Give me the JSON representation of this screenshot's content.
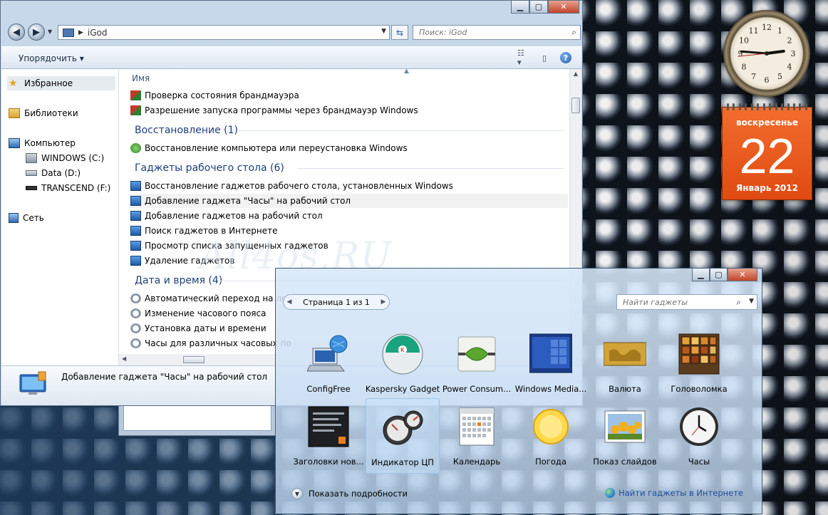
{
  "explorer": {
    "address": {
      "crumb": "iGod"
    },
    "search": {
      "placeholder": "Поиск: iGod"
    },
    "toolbar": {
      "organize_label": "Упорядочить ▾"
    },
    "nav": {
      "favorites": "Избранное",
      "libraries": "Библиотеки",
      "computer": "Компьютер",
      "drive_c": "WINDOWS (C:)",
      "drive_d": "Data (D:)",
      "drive_f": "TRANSCEND (F:)",
      "network": "Сеть"
    },
    "column_header": "Имя",
    "items_top": [
      "Проверка состояния брандмауэра",
      "Разрешение запуска программы через брандмауэр Windows"
    ],
    "groups": [
      {
        "title": "Восстановление (1)",
        "items": [
          "Восстановление компьютера или переустановка Windows"
        ]
      },
      {
        "title": "Гаджеты рабочего стола (6)",
        "items": [
          "Восстановление гаджетов рабочего стола, установленных Windows",
          "Добавление гаджета \"Часы\" на рабочий стол",
          "Добавление гаджетов на рабочий стол",
          "Поиск гаджетов в Интернете",
          "Просмотр списка запущенных гаджетов",
          "Удаление гаджетов"
        ]
      },
      {
        "title": "Дата и время (4)",
        "items": [
          "Автоматический переход на летн",
          "Изменение часового пояса",
          "Установка даты и времени",
          "Часы для различных часовых по"
        ]
      }
    ],
    "details_text": "Добавление гаджета \"Часы\" на рабочий стол"
  },
  "watermark": "All4os.RU",
  "clock": {
    "hour": 2,
    "minute": 45,
    "second": 44
  },
  "calendar": {
    "weekday": "воскресенье",
    "day": "22",
    "month_year": "Январь 2012"
  },
  "gallery": {
    "pager": "Страница 1 из 1",
    "search_placeholder": "Найти гаджеты",
    "tiles": [
      "ConfigFree",
      "Kaspersky Gadget",
      "Power Consum...",
      "Windows Media...",
      "Валюта",
      "Головоломка",
      "Заголовки нов...",
      "Индикатор ЦП",
      "Календарь",
      "Погода",
      "Показ слайдов",
      "Часы"
    ],
    "show_details": "Показать подробности",
    "find_online": "Найти гаджеты в Интернете"
  },
  "colors": {
    "calendar_orange": "#e85a1c",
    "group_blue": "#1e3f7c",
    "link_blue": "#1a4fa0"
  }
}
